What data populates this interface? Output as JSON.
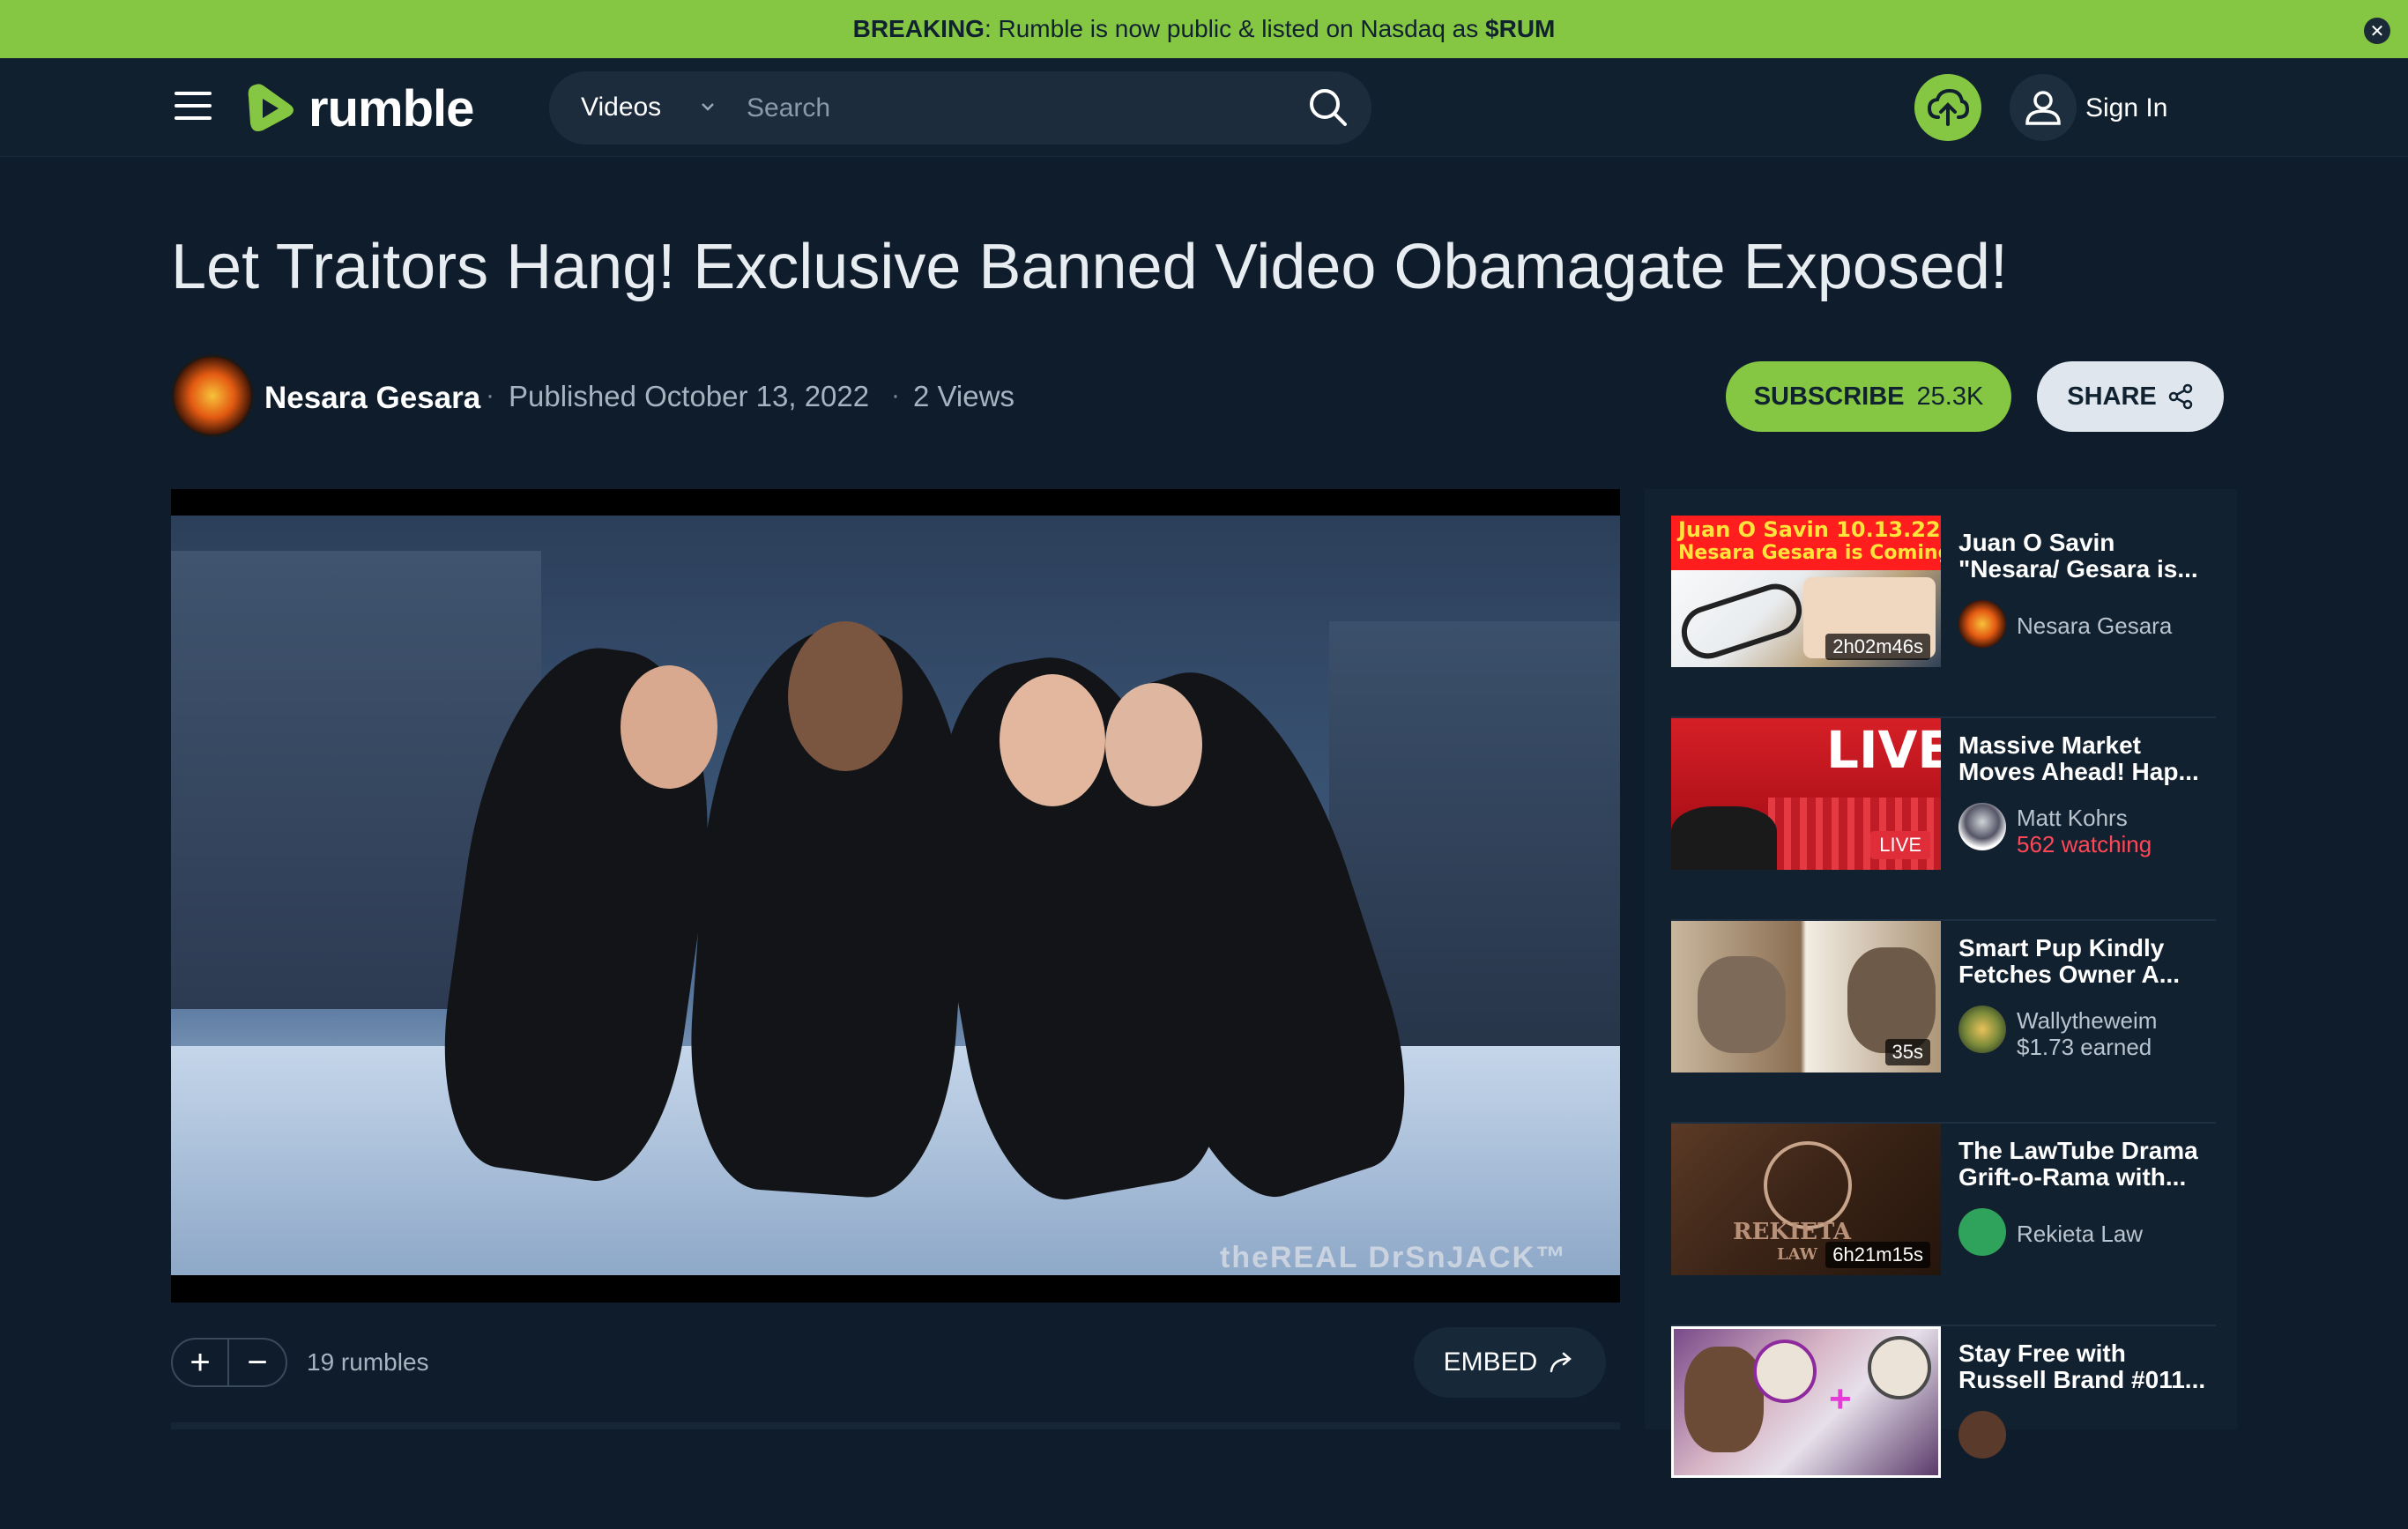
{
  "banner": {
    "label": "BREAKING",
    "text": ": Rumble is now public & listed on Nasdaq as ",
    "ticker": "$RUM"
  },
  "header": {
    "logo_text": "rumble",
    "search": {
      "category": "Videos",
      "placeholder": "Search"
    },
    "sign_in": "Sign In"
  },
  "video": {
    "title": "Let Traitors Hang! Exclusive Banned Video Obamagate Exposed!",
    "channel": "Nesara Gesara",
    "published": "Published October 13, 2022",
    "views": "2 Views",
    "subscribe_label": "SUBSCRIBE",
    "subscriber_count": "25.3K",
    "share_label": "SHARE",
    "watermark": "theREAL DrSnJACK™",
    "rumbles": "19 rumbles",
    "embed_label": "EMBED",
    "separator": "·"
  },
  "related": [
    {
      "title": "Juan O Savin \"Nesara/ Gesara is...",
      "channel": "Nesara Gesara",
      "duration": "2h02m46s",
      "thumb_text_1": "Juan O Savin 10.13.22",
      "thumb_text_2": "Nesara Gesara is Coming",
      "meta": ""
    },
    {
      "title": "Massive Market Moves Ahead! Hap...",
      "channel": "Matt Kohrs",
      "live": "LIVE",
      "thumb_text_1": "LIVE",
      "meta": "562 watching"
    },
    {
      "title": "Smart Pup Kindly Fetches Owner A...",
      "channel": "Wallytheweim",
      "duration": "35s",
      "meta": "$1.73 earned"
    },
    {
      "title": "The LawTube Drama Grift-o-Rama with...",
      "channel": "Rekieta Law",
      "duration": "6h21m15s",
      "thumb_text_1": "REKIETA",
      "thumb_text_2": "LAW",
      "meta": ""
    },
    {
      "title": "Stay Free with Russell Brand #011...",
      "channel": "",
      "meta": ""
    }
  ],
  "colors": {
    "accent_green": "#85c742",
    "page_bg": "#0f1c2b",
    "live_red": "#e02d3a"
  }
}
